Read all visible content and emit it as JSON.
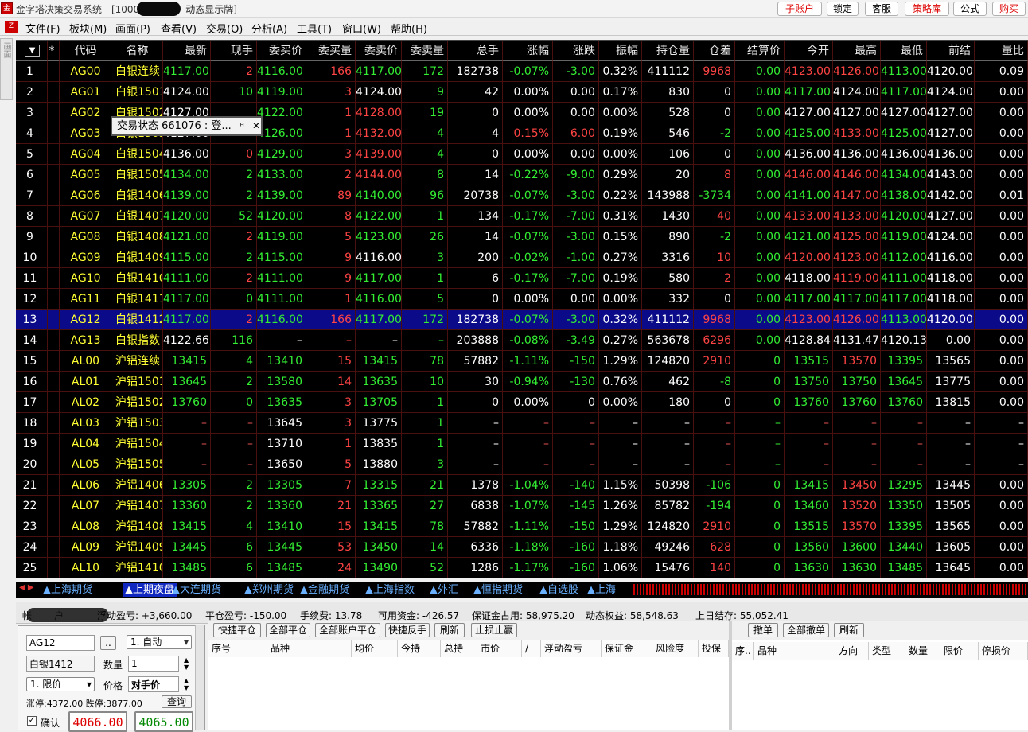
{
  "window": {
    "title_left": "金字塔决策交易系统 - [1000",
    "title_right": "动态显示牌]",
    "icon": "app-logo-icon"
  },
  "title_buttons": [
    "子账户",
    "锁定",
    "客服",
    "策略库",
    "公式",
    "购买"
  ],
  "menu": [
    "文件(F)",
    "板块(M)",
    "画面(P)",
    "查看(V)",
    "交易(O)",
    "分析(A)",
    "工具(T)",
    "窗口(W)",
    "帮助(H)"
  ],
  "left_tab": "画面",
  "columns": [
    "",
    "*",
    "代码",
    "名称",
    "最新",
    "现手",
    "委买价",
    "委买量",
    "委卖价",
    "委卖量",
    "总手",
    "涨幅",
    "涨跌",
    "振幅",
    "持仓量",
    "仓差",
    "结算价",
    "今开",
    "最高",
    "最低",
    "前结",
    "量比"
  ],
  "colors": {
    "red": "#ff4444",
    "green": "#33ee33",
    "yellow": "#ffff33",
    "white": "#ffffff"
  },
  "rows": [
    [
      "1",
      "",
      "AG00",
      "白银连续",
      "4117.00",
      "2",
      "4116.00",
      "166",
      "4117.00",
      "172",
      "182738",
      "-0.07%",
      "-3.00",
      "0.32%",
      "411112",
      "9968",
      "0.00",
      "4123.00",
      "4126.00",
      "4113.00",
      "4120.00",
      "0.09"
    ],
    [
      "2",
      "",
      "AG01",
      "白银1501",
      "4124.00",
      "10",
      "4119.00",
      "3",
      "4124.00",
      "9",
      "42",
      "0.00%",
      "0.00",
      "0.17%",
      "830",
      "0",
      "0.00",
      "4117.00",
      "4124.00",
      "4117.00",
      "4124.00",
      "0.00"
    ],
    [
      "3",
      "",
      "AG02",
      "白银1502",
      "4127.00",
      "",
      "4122.00",
      "1",
      "4128.00",
      "19",
      "0",
      "0.00%",
      "0.00",
      "0.00%",
      "528",
      "0",
      "0.00",
      "4127.00",
      "4127.00",
      "4127.00",
      "4127.00",
      "0.00"
    ],
    [
      "4",
      "",
      "AG03",
      "白银1503",
      "4127.00",
      "",
      "4126.00",
      "1",
      "4132.00",
      "4",
      "4",
      "0.15%",
      "6.00",
      "0.19%",
      "546",
      "-2",
      "0.00",
      "4125.00",
      "4133.00",
      "4125.00",
      "4127.00",
      "0.00"
    ],
    [
      "5",
      "",
      "AG04",
      "白银1504",
      "4136.00",
      "0",
      "4129.00",
      "3",
      "4139.00",
      "4",
      "0",
      "0.00%",
      "0.00",
      "0.00%",
      "106",
      "0",
      "0.00",
      "4136.00",
      "4136.00",
      "4136.00",
      "4136.00",
      "0.00"
    ],
    [
      "6",
      "",
      "AG05",
      "白银1505",
      "4134.00",
      "2",
      "4133.00",
      "2",
      "4144.00",
      "8",
      "14",
      "-0.22%",
      "-9.00",
      "0.29%",
      "20",
      "8",
      "0.00",
      "4146.00",
      "4146.00",
      "4134.00",
      "4143.00",
      "0.00"
    ],
    [
      "7",
      "",
      "AG06",
      "白银1406",
      "4139.00",
      "2",
      "4139.00",
      "89",
      "4140.00",
      "96",
      "20738",
      "-0.07%",
      "-3.00",
      "0.22%",
      "143988",
      "-3734",
      "0.00",
      "4141.00",
      "4147.00",
      "4138.00",
      "4142.00",
      "0.01"
    ],
    [
      "8",
      "",
      "AG07",
      "白银1407",
      "4120.00",
      "52",
      "4120.00",
      "8",
      "4122.00",
      "1",
      "134",
      "-0.17%",
      "-7.00",
      "0.31%",
      "1430",
      "40",
      "0.00",
      "4133.00",
      "4133.00",
      "4120.00",
      "4127.00",
      "0.00"
    ],
    [
      "9",
      "",
      "AG08",
      "白银1408",
      "4121.00",
      "2",
      "4119.00",
      "5",
      "4123.00",
      "26",
      "14",
      "-0.07%",
      "-3.00",
      "0.15%",
      "890",
      "-2",
      "0.00",
      "4121.00",
      "4125.00",
      "4119.00",
      "4124.00",
      "0.00"
    ],
    [
      "10",
      "",
      "AG09",
      "白银1409",
      "4115.00",
      "2",
      "4115.00",
      "9",
      "4116.00",
      "3",
      "200",
      "-0.02%",
      "-1.00",
      "0.27%",
      "3316",
      "10",
      "0.00",
      "4120.00",
      "4123.00",
      "4112.00",
      "4116.00",
      "0.00"
    ],
    [
      "11",
      "",
      "AG10",
      "白银1410",
      "4111.00",
      "2",
      "4111.00",
      "9",
      "4117.00",
      "1",
      "6",
      "-0.17%",
      "-7.00",
      "0.19%",
      "580",
      "2",
      "0.00",
      "4118.00",
      "4119.00",
      "4111.00",
      "4118.00",
      "0.00"
    ],
    [
      "12",
      "",
      "AG11",
      "白银1411",
      "4117.00",
      "0",
      "4111.00",
      "1",
      "4116.00",
      "5",
      "0",
      "0.00%",
      "0.00",
      "0.00%",
      "332",
      "0",
      "0.00",
      "4117.00",
      "4117.00",
      "4117.00",
      "4118.00",
      "0.00"
    ],
    [
      "13",
      "",
      "AG12",
      "白银1412",
      "4117.00",
      "2",
      "4116.00",
      "166",
      "4117.00",
      "172",
      "182738",
      "-0.07%",
      "-3.00",
      "0.32%",
      "411112",
      "9968",
      "0.00",
      "4123.00",
      "4126.00",
      "4113.00",
      "4120.00",
      "0.00"
    ],
    [
      "14",
      "",
      "AG13",
      "白银指数",
      "4122.66",
      "116",
      "–",
      "–",
      "–",
      "–",
      "203888",
      "-0.08%",
      "-3.49",
      "0.27%",
      "563678",
      "6296",
      "0.00",
      "4128.84",
      "4131.47",
      "4120.13",
      "0.00",
      "0.00"
    ],
    [
      "15",
      "",
      "AL00",
      "沪铝连续",
      "13415",
      "4",
      "13410",
      "15",
      "13415",
      "78",
      "57882",
      "-1.11%",
      "-150",
      "1.29%",
      "124820",
      "2910",
      "0",
      "13515",
      "13570",
      "13395",
      "13565",
      "0.00"
    ],
    [
      "16",
      "",
      "AL01",
      "沪铝1501",
      "13645",
      "2",
      "13580",
      "14",
      "13635",
      "10",
      "30",
      "-0.94%",
      "-130",
      "0.76%",
      "462",
      "-8",
      "0",
      "13750",
      "13750",
      "13645",
      "13775",
      "0.00"
    ],
    [
      "17",
      "",
      "AL02",
      "沪铝1502",
      "13760",
      "0",
      "13635",
      "3",
      "13705",
      "1",
      "0",
      "0.00%",
      "0",
      "0.00%",
      "180",
      "0",
      "0",
      "13760",
      "13760",
      "13760",
      "13815",
      "0.00"
    ],
    [
      "18",
      "",
      "AL03",
      "沪铝1503",
      "–",
      "–",
      "13645",
      "3",
      "13775",
      "1",
      "–",
      "–",
      "–",
      "–",
      "–",
      "–",
      "–",
      "–",
      "–",
      "–",
      "–",
      "–"
    ],
    [
      "19",
      "",
      "AL04",
      "沪铝1504",
      "–",
      "–",
      "13710",
      "1",
      "13835",
      "1",
      "–",
      "–",
      "–",
      "–",
      "–",
      "–",
      "–",
      "–",
      "–",
      "–",
      "–",
      "–"
    ],
    [
      "20",
      "",
      "AL05",
      "沪铝1505",
      "–",
      "–",
      "13650",
      "5",
      "13880",
      "3",
      "–",
      "–",
      "–",
      "–",
      "–",
      "–",
      "–",
      "–",
      "–",
      "–",
      "–",
      "–"
    ],
    [
      "21",
      "",
      "AL06",
      "沪铝1406",
      "13305",
      "2",
      "13305",
      "7",
      "13315",
      "21",
      "1378",
      "-1.04%",
      "-140",
      "1.15%",
      "50398",
      "-106",
      "0",
      "13415",
      "13450",
      "13295",
      "13445",
      "0.00"
    ],
    [
      "22",
      "",
      "AL07",
      "沪铝1407",
      "13360",
      "2",
      "13360",
      "21",
      "13365",
      "27",
      "6838",
      "-1.07%",
      "-145",
      "1.26%",
      "85782",
      "-194",
      "0",
      "13460",
      "13520",
      "13350",
      "13505",
      "0.00"
    ],
    [
      "23",
      "",
      "AL08",
      "沪铝1408",
      "13415",
      "4",
      "13410",
      "15",
      "13415",
      "78",
      "57882",
      "-1.11%",
      "-150",
      "1.29%",
      "124820",
      "2910",
      "0",
      "13515",
      "13570",
      "13395",
      "13565",
      "0.00"
    ],
    [
      "24",
      "",
      "AL09",
      "沪铝1409",
      "13445",
      "6",
      "13445",
      "53",
      "13450",
      "14",
      "6336",
      "-1.18%",
      "-160",
      "1.18%",
      "49246",
      "628",
      "0",
      "13560",
      "13600",
      "13440",
      "13605",
      "0.00"
    ],
    [
      "25",
      "",
      "AL10",
      "沪铝1410",
      "13485",
      "6",
      "13485",
      "24",
      "13490",
      "52",
      "1286",
      "-1.17%",
      "-160",
      "1.06%",
      "15476",
      "140",
      "0",
      "13630",
      "13630",
      "13485",
      "13645",
      "0.00"
    ]
  ],
  "popup": {
    "text": "交易状态 661076 : 登...",
    "pin": "ꟸ",
    "close": "✕"
  },
  "sheet_tabs": [
    "上海期货",
    "上期夜盘",
    "大连期货",
    "郑州期货",
    "金融期货",
    "上海指数",
    "外汇",
    "恒指期货",
    "自选股",
    "上海"
  ],
  "active_tab": 1,
  "account": {
    "label_a": "帐",
    "label_b": "户",
    "float": "浮动盈亏: +3,660.00",
    "close": "平仓盈亏: -150.00",
    "fee": "手续费: 13.78",
    "avail": "可用资金: -426.57",
    "margin": "保证金占用: 58,975.20",
    "equity": "动态权益: 58,548.63",
    "prev": "上日结存: 55,052.41"
  },
  "order": {
    "code": "AG12",
    "more": "..",
    "mode": "1. 自动",
    "name": "白银1412",
    "qty_label": "数量",
    "qty": "1",
    "price_type": "1. 限价",
    "price_label": "价格",
    "price": "对手价",
    "limits": "涨停:4372.00 跌停:3877.00",
    "query": "查询",
    "confirm": "确认",
    "bid": "4066.00",
    "ask": "4065.00"
  },
  "pos_buttons": [
    "快捷平仓",
    "全部平仓",
    "全部账户平仓",
    "快捷反手",
    "刷新",
    "止损止赢"
  ],
  "pos_headers": [
    "序号",
    "品种",
    "均价",
    "今持",
    "总持",
    "市价",
    "/",
    "浮动盈亏",
    "保证金",
    "风险度",
    "投保"
  ],
  "ord_buttons": [
    "撤单",
    "全部撤单",
    "刷新"
  ],
  "ord_headers": [
    "序..",
    "品种",
    "方向",
    "类型",
    "数量",
    "限价",
    "停损价"
  ]
}
